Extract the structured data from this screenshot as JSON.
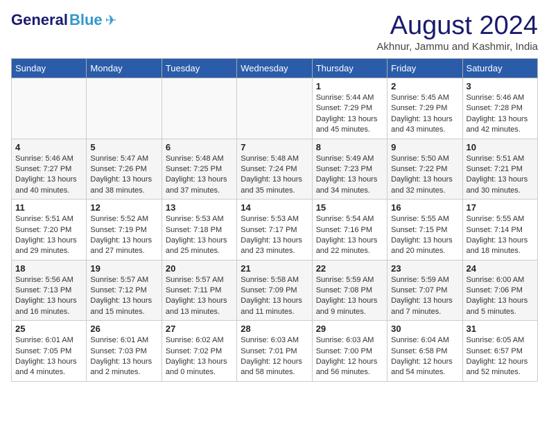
{
  "header": {
    "logo_general": "General",
    "logo_blue": "Blue",
    "month_title": "August 2024",
    "location": "Akhnur, Jammu and Kashmir, India"
  },
  "weekdays": [
    "Sunday",
    "Monday",
    "Tuesday",
    "Wednesday",
    "Thursday",
    "Friday",
    "Saturday"
  ],
  "weeks": [
    [
      {
        "day": "",
        "info": ""
      },
      {
        "day": "",
        "info": ""
      },
      {
        "day": "",
        "info": ""
      },
      {
        "day": "",
        "info": ""
      },
      {
        "day": "1",
        "info": "Sunrise: 5:44 AM\nSunset: 7:29 PM\nDaylight: 13 hours\nand 45 minutes."
      },
      {
        "day": "2",
        "info": "Sunrise: 5:45 AM\nSunset: 7:29 PM\nDaylight: 13 hours\nand 43 minutes."
      },
      {
        "day": "3",
        "info": "Sunrise: 5:46 AM\nSunset: 7:28 PM\nDaylight: 13 hours\nand 42 minutes."
      }
    ],
    [
      {
        "day": "4",
        "info": "Sunrise: 5:46 AM\nSunset: 7:27 PM\nDaylight: 13 hours\nand 40 minutes."
      },
      {
        "day": "5",
        "info": "Sunrise: 5:47 AM\nSunset: 7:26 PM\nDaylight: 13 hours\nand 38 minutes."
      },
      {
        "day": "6",
        "info": "Sunrise: 5:48 AM\nSunset: 7:25 PM\nDaylight: 13 hours\nand 37 minutes."
      },
      {
        "day": "7",
        "info": "Sunrise: 5:48 AM\nSunset: 7:24 PM\nDaylight: 13 hours\nand 35 minutes."
      },
      {
        "day": "8",
        "info": "Sunrise: 5:49 AM\nSunset: 7:23 PM\nDaylight: 13 hours\nand 34 minutes."
      },
      {
        "day": "9",
        "info": "Sunrise: 5:50 AM\nSunset: 7:22 PM\nDaylight: 13 hours\nand 32 minutes."
      },
      {
        "day": "10",
        "info": "Sunrise: 5:51 AM\nSunset: 7:21 PM\nDaylight: 13 hours\nand 30 minutes."
      }
    ],
    [
      {
        "day": "11",
        "info": "Sunrise: 5:51 AM\nSunset: 7:20 PM\nDaylight: 13 hours\nand 29 minutes."
      },
      {
        "day": "12",
        "info": "Sunrise: 5:52 AM\nSunset: 7:19 PM\nDaylight: 13 hours\nand 27 minutes."
      },
      {
        "day": "13",
        "info": "Sunrise: 5:53 AM\nSunset: 7:18 PM\nDaylight: 13 hours\nand 25 minutes."
      },
      {
        "day": "14",
        "info": "Sunrise: 5:53 AM\nSunset: 7:17 PM\nDaylight: 13 hours\nand 23 minutes."
      },
      {
        "day": "15",
        "info": "Sunrise: 5:54 AM\nSunset: 7:16 PM\nDaylight: 13 hours\nand 22 minutes."
      },
      {
        "day": "16",
        "info": "Sunrise: 5:55 AM\nSunset: 7:15 PM\nDaylight: 13 hours\nand 20 minutes."
      },
      {
        "day": "17",
        "info": "Sunrise: 5:55 AM\nSunset: 7:14 PM\nDaylight: 13 hours\nand 18 minutes."
      }
    ],
    [
      {
        "day": "18",
        "info": "Sunrise: 5:56 AM\nSunset: 7:13 PM\nDaylight: 13 hours\nand 16 minutes."
      },
      {
        "day": "19",
        "info": "Sunrise: 5:57 AM\nSunset: 7:12 PM\nDaylight: 13 hours\nand 15 minutes."
      },
      {
        "day": "20",
        "info": "Sunrise: 5:57 AM\nSunset: 7:11 PM\nDaylight: 13 hours\nand 13 minutes."
      },
      {
        "day": "21",
        "info": "Sunrise: 5:58 AM\nSunset: 7:09 PM\nDaylight: 13 hours\nand 11 minutes."
      },
      {
        "day": "22",
        "info": "Sunrise: 5:59 AM\nSunset: 7:08 PM\nDaylight: 13 hours\nand 9 minutes."
      },
      {
        "day": "23",
        "info": "Sunrise: 5:59 AM\nSunset: 7:07 PM\nDaylight: 13 hours\nand 7 minutes."
      },
      {
        "day": "24",
        "info": "Sunrise: 6:00 AM\nSunset: 7:06 PM\nDaylight: 13 hours\nand 5 minutes."
      }
    ],
    [
      {
        "day": "25",
        "info": "Sunrise: 6:01 AM\nSunset: 7:05 PM\nDaylight: 13 hours\nand 4 minutes."
      },
      {
        "day": "26",
        "info": "Sunrise: 6:01 AM\nSunset: 7:03 PM\nDaylight: 13 hours\nand 2 minutes."
      },
      {
        "day": "27",
        "info": "Sunrise: 6:02 AM\nSunset: 7:02 PM\nDaylight: 13 hours\nand 0 minutes."
      },
      {
        "day": "28",
        "info": "Sunrise: 6:03 AM\nSunset: 7:01 PM\nDaylight: 12 hours\nand 58 minutes."
      },
      {
        "day": "29",
        "info": "Sunrise: 6:03 AM\nSunset: 7:00 PM\nDaylight: 12 hours\nand 56 minutes."
      },
      {
        "day": "30",
        "info": "Sunrise: 6:04 AM\nSunset: 6:58 PM\nDaylight: 12 hours\nand 54 minutes."
      },
      {
        "day": "31",
        "info": "Sunrise: 6:05 AM\nSunset: 6:57 PM\nDaylight: 12 hours\nand 52 minutes."
      }
    ]
  ]
}
